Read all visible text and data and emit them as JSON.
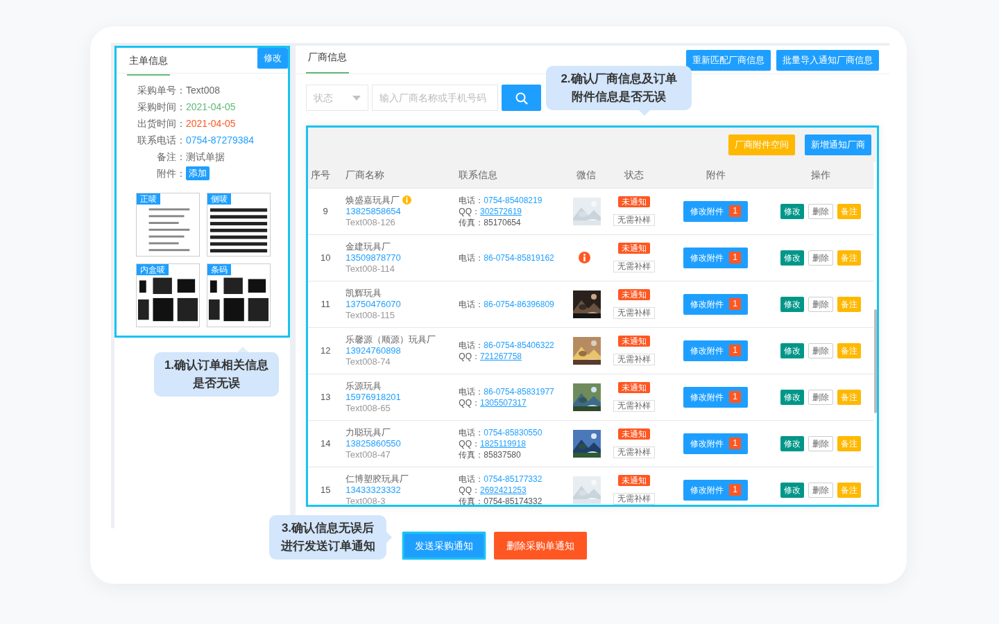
{
  "order_panel": {
    "tab": "主单信息",
    "edit_button": "修改",
    "info": [
      {
        "label": "采购单号：",
        "value": "Text008",
        "kind": "plain"
      },
      {
        "label": "采购时间：",
        "value": "2021-04-05",
        "kind": "green"
      },
      {
        "label": "出货时间：",
        "value": "2021-04-05",
        "kind": "red"
      },
      {
        "label": "联系电话：",
        "value": "0754-87279384",
        "kind": "blue"
      },
      {
        "label": "备注：",
        "value": "测试单据",
        "kind": "plain"
      },
      {
        "label": "附件：",
        "value": "添加",
        "kind": "button"
      }
    ],
    "attachments": [
      {
        "tag": "正唛",
        "kind": "picture"
      },
      {
        "tag": "侧唛",
        "kind": "picture"
      },
      {
        "tag": "内盒唛",
        "kind": "picture"
      },
      {
        "tag": "条码",
        "kind": "picture"
      }
    ]
  },
  "supplier_panel": {
    "tab": "厂商信息",
    "header_buttons": [
      "重新匹配厂商信息",
      "批量导入通知厂商信息"
    ],
    "filter": {
      "status_placeholder": "状态",
      "search_placeholder": "输入厂商名称或手机号码"
    },
    "toolbar_buttons": [
      {
        "label": "厂商附件空间",
        "kind": "warning"
      },
      {
        "label": "新增通知厂商",
        "kind": "primary"
      }
    ],
    "table": {
      "columns": [
        "序号",
        "厂商名称",
        "联系信息",
        "微信",
        "状态",
        "附件",
        "操作"
      ],
      "rows": [
        {
          "no": "9",
          "name": "焕盛嘉玩具厂",
          "warn": true,
          "mobile": "13825858654",
          "code": "Text008-126",
          "contacts": [
            {
              "label": "电话：",
              "value": "0754-85408219",
              "kind": "phone"
            },
            {
              "label": "QQ：",
              "value": "302572619",
              "kind": "qq"
            },
            {
              "label": "传真：",
              "value": "85170654",
              "kind": "fax"
            }
          ],
          "wechat": {
            "kind": "picture"
          },
          "status": "未通知",
          "sample": "无需补样",
          "attach_button": "修改附件",
          "attach_count": "1",
          "actions": [
            "修改",
            "删除",
            "备注"
          ]
        },
        {
          "no": "10",
          "name": "金建玩具厂",
          "warn": false,
          "mobile": "13509878770",
          "code": "Text008-114",
          "contacts": [
            {
              "label": "电话：",
              "value": "86-0754-85819162",
              "kind": "phone"
            }
          ],
          "wechat": {
            "kind": "missing"
          },
          "status": "未通知",
          "sample": "无需补样",
          "attach_button": "修改附件",
          "attach_count": "1",
          "actions": [
            "修改",
            "删除",
            "备注"
          ]
        },
        {
          "no": "11",
          "name": "凯辉玩具",
          "warn": false,
          "mobile": "13750476070",
          "code": "Text008-115",
          "contacts": [
            {
              "label": "电话：",
              "value": "86-0754-86396809",
              "kind": "phone"
            }
          ],
          "wechat": {
            "kind": "picture"
          },
          "status": "未通知",
          "sample": "无需补样",
          "attach_button": "修改附件",
          "attach_count": "1",
          "actions": [
            "修改",
            "删除",
            "备注"
          ]
        },
        {
          "no": "12",
          "name": "乐馨源（顺源）玩具厂",
          "warn": false,
          "mobile": "13924760898",
          "code": "Text008-74",
          "contacts": [
            {
              "label": "电话：",
              "value": "86-0754-85406322",
              "kind": "phone"
            },
            {
              "label": "QQ：",
              "value": "721267758",
              "kind": "qq"
            }
          ],
          "wechat": {
            "kind": "picture"
          },
          "status": "未通知",
          "sample": "无需补样",
          "attach_button": "修改附件",
          "attach_count": "1",
          "actions": [
            "修改",
            "删除",
            "备注"
          ]
        },
        {
          "no": "13",
          "name": "乐源玩具",
          "warn": false,
          "mobile": "15976918201",
          "code": "Text008-65",
          "contacts": [
            {
              "label": "电话：",
              "value": "86-0754-85831977",
              "kind": "phone"
            },
            {
              "label": "QQ：",
              "value": "1305507317",
              "kind": "qq"
            }
          ],
          "wechat": {
            "kind": "picture"
          },
          "status": "未通知",
          "sample": "无需补样",
          "attach_button": "修改附件",
          "attach_count": "1",
          "actions": [
            "修改",
            "删除",
            "备注"
          ]
        },
        {
          "no": "14",
          "name": "力聪玩具厂",
          "warn": false,
          "mobile": "13825860550",
          "code": "Text008-47",
          "contacts": [
            {
              "label": "电话：",
              "value": "0754-85830550",
              "kind": "phone"
            },
            {
              "label": "QQ：",
              "value": "1825119918",
              "kind": "qq"
            },
            {
              "label": "传真：",
              "value": "85837580",
              "kind": "fax"
            }
          ],
          "wechat": {
            "kind": "picture"
          },
          "status": "未通知",
          "sample": "无需补样",
          "attach_button": "修改附件",
          "attach_count": "1",
          "actions": [
            "修改",
            "删除",
            "备注"
          ]
        },
        {
          "no": "15",
          "name": "仁博塑胶玩具厂",
          "warn": false,
          "mobile": "13433323332",
          "code": "Text008-3",
          "contacts": [
            {
              "label": "电话：",
              "value": "0754-85177332",
              "kind": "phone"
            },
            {
              "label": "QQ：",
              "value": "2692421253",
              "kind": "qq"
            },
            {
              "label": "传真：",
              "value": "0754-85174332",
              "kind": "fax"
            }
          ],
          "wechat": {
            "kind": "picture"
          },
          "status": "未通知",
          "sample": "无需补样",
          "attach_button": "修改附件",
          "attach_count": "1",
          "actions": [
            "修改",
            "删除",
            "备注"
          ]
        }
      ]
    }
  },
  "footer_buttons": [
    {
      "label": "发送采购通知",
      "kind": "primary"
    },
    {
      "label": "删除采购单通知",
      "kind": "danger"
    }
  ],
  "callouts": [
    {
      "lines": [
        "1.确认订单相关信息",
        "是否无误"
      ]
    },
    {
      "lines": [
        "2.确认厂商信息及订单",
        "附件信息是否无误"
      ]
    },
    {
      "lines": [
        "3.确认信息无误后",
        "进行发送订单通知"
      ]
    }
  ]
}
